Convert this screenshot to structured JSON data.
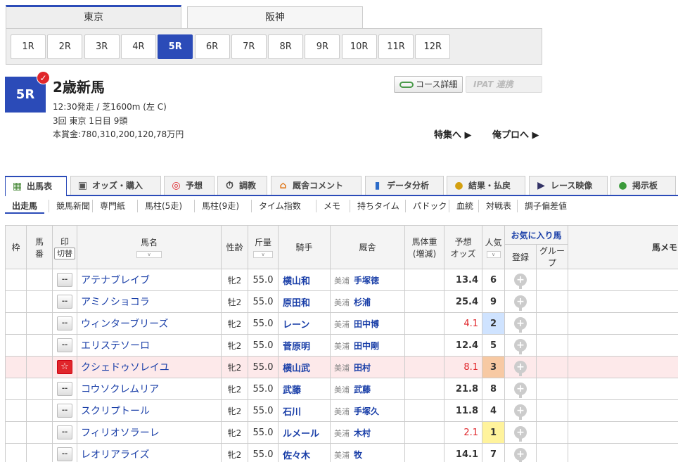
{
  "venues": {
    "active": "東京",
    "other": "阪神"
  },
  "races": [
    "1R",
    "2R",
    "3R",
    "4R",
    "5R",
    "6R",
    "7R",
    "8R",
    "9R",
    "10R",
    "11R",
    "12R"
  ],
  "header": {
    "race_num": "5R",
    "title": "2歳新馬",
    "line1": "12:30発走 / 芝1600m (左 C)",
    "line2": "3回 東京 1日目 9頭",
    "line3": "本賞金:780,310,200,120,78万円",
    "course_btn": "コース詳細",
    "ipat_btn": "IPAT 連携",
    "link_special": "特集へ ▶",
    "link_blog": "俺プロへ ▶"
  },
  "main_tabs": [
    "出馬表",
    "オッズ・購入",
    "予想",
    "調教",
    "厩舎コメント",
    "データ分析",
    "結果・払戻",
    "レース映像",
    "掲示板"
  ],
  "sub_tabs": [
    "出走馬",
    "競馬新聞",
    "専門紙",
    "馬柱(5走)",
    "馬柱(9走)",
    "タイム指数",
    "メモ",
    "持ちタイム",
    "パドック",
    "血統",
    "対戦表",
    "調子偏差値"
  ],
  "columns": {
    "waku": "枠",
    "umaban_1": "馬",
    "umaban_2": "番",
    "mark": "印",
    "mark_btn": "切替",
    "horse": "馬名",
    "sex_age": "性齢",
    "weight": "斤量",
    "jockey": "騎手",
    "trainer": "厩舎",
    "body_1": "馬体重",
    "body_2": "(増減)",
    "odds_1": "予想",
    "odds_2": "オッズ",
    "pop": "人気",
    "fav": "お気に入り馬",
    "fav_reg": "登録",
    "fav_group": "グループ",
    "memo": "馬メモ"
  },
  "entries": [
    {
      "mark": "--",
      "horse": "アテナブレイブ",
      "sex_age": "牝2",
      "weight": "55.0",
      "jockey": "横山和",
      "region": "美浦",
      "trainer": "手塚徳",
      "odds": "13.4",
      "pop": "6"
    },
    {
      "mark": "--",
      "horse": "アミノショコラ",
      "sex_age": "牡2",
      "weight": "55.0",
      "jockey": "原田和",
      "region": "美浦",
      "trainer": "杉浦",
      "odds": "25.4",
      "pop": "9"
    },
    {
      "mark": "--",
      "horse": "ウィンターブリーズ",
      "sex_age": "牝2",
      "weight": "55.0",
      "jockey": "レーン",
      "region": "美浦",
      "trainer": "田中博",
      "odds": "4.1",
      "pop": "2"
    },
    {
      "mark": "--",
      "horse": "エリステソーロ",
      "sex_age": "牝2",
      "weight": "55.0",
      "jockey": "菅原明",
      "region": "美浦",
      "trainer": "田中剛",
      "odds": "12.4",
      "pop": "5"
    },
    {
      "mark": "☆",
      "horse": "クシェドゥソレイユ",
      "sex_age": "牝2",
      "weight": "55.0",
      "jockey": "横山武",
      "region": "美浦",
      "trainer": "田村",
      "odds": "8.1",
      "pop": "3"
    },
    {
      "mark": "--",
      "horse": "コウソクレムリア",
      "sex_age": "牝2",
      "weight": "55.0",
      "jockey": "武藤",
      "region": "美浦",
      "trainer": "武藤",
      "odds": "21.8",
      "pop": "8"
    },
    {
      "mark": "--",
      "horse": "スクリプトール",
      "sex_age": "牝2",
      "weight": "55.0",
      "jockey": "石川",
      "region": "美浦",
      "trainer": "手塚久",
      "odds": "11.8",
      "pop": "4"
    },
    {
      "mark": "--",
      "horse": "フィリオソラーレ",
      "sex_age": "牝2",
      "weight": "55.0",
      "jockey": "ルメール",
      "region": "美浦",
      "trainer": "木村",
      "odds": "2.1",
      "pop": "1"
    },
    {
      "mark": "--",
      "horse": "レオリアライズ",
      "sex_age": "牝2",
      "weight": "55.0",
      "jockey": "佐々木",
      "region": "美浦",
      "trainer": "牧",
      "odds": "14.1",
      "pop": "7"
    }
  ],
  "colors": {
    "accent": "#2b4bb8",
    "hot": "#e0262b",
    "pop1": "#fff39c",
    "pop2": "#cfe3ff",
    "pop3": "#f7c9a3",
    "highlight_row": "#fde9ea"
  }
}
